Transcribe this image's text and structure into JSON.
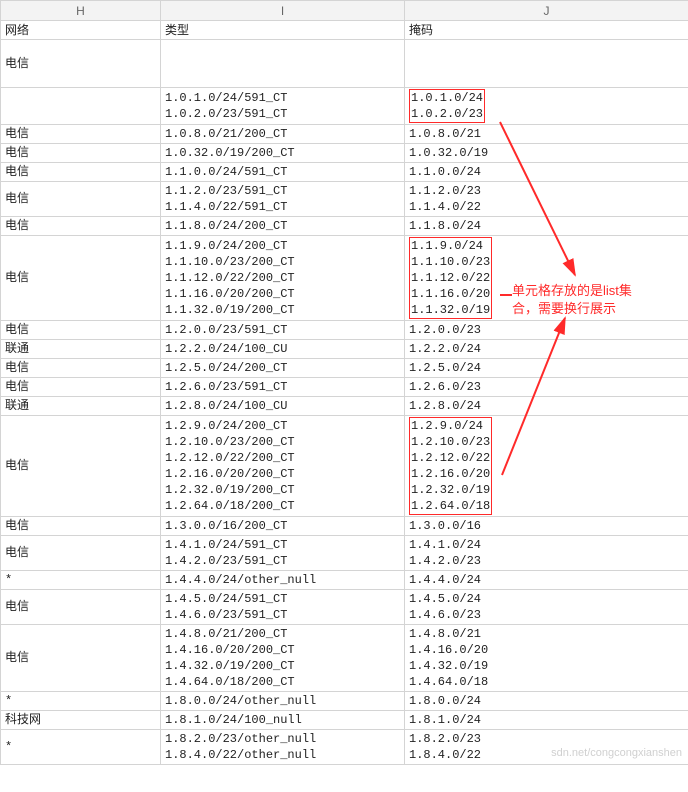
{
  "columns": {
    "H": "H",
    "I": "I",
    "J": "J"
  },
  "headerRow": {
    "H": "网络",
    "I": "类型",
    "J": "掩码"
  },
  "annotation": {
    "line1": "单元格存放的是list集",
    "line2": "合，需要换行展示"
  },
  "watermark": "sdn.net/congcongxianshen",
  "rows": [
    {
      "h": "电信",
      "i": [
        ""
      ],
      "j": [
        ""
      ],
      "jbox": false,
      "blank": true
    },
    {
      "h": "",
      "i": [
        "1.0.1.0/24/591_CT",
        "1.0.2.0/23/591_CT"
      ],
      "j": [
        "1.0.1.0/24",
        "1.0.2.0/23"
      ],
      "jbox": true
    },
    {
      "h": "电信",
      "i": [
        "1.0.8.0/21/200_CT"
      ],
      "j": [
        "1.0.8.0/21"
      ],
      "jbox": false
    },
    {
      "h": "电信",
      "i": [
        "1.0.32.0/19/200_CT"
      ],
      "j": [
        "1.0.32.0/19"
      ],
      "jbox": false
    },
    {
      "h": "电信",
      "i": [
        "1.1.0.0/24/591_CT"
      ],
      "j": [
        "1.1.0.0/24"
      ],
      "jbox": false
    },
    {
      "h": "电信",
      "i": [
        "1.1.2.0/23/591_CT",
        "1.1.4.0/22/591_CT"
      ],
      "j": [
        "1.1.2.0/23",
        "1.1.4.0/22"
      ],
      "jbox": false
    },
    {
      "h": "电信",
      "i": [
        "1.1.8.0/24/200_CT"
      ],
      "j": [
        "1.1.8.0/24"
      ],
      "jbox": false
    },
    {
      "h": "电信",
      "i": [
        "1.1.9.0/24/200_CT",
        "1.1.10.0/23/200_CT",
        "1.1.12.0/22/200_CT",
        "1.1.16.0/20/200_CT",
        "1.1.32.0/19/200_CT"
      ],
      "j": [
        "1.1.9.0/24",
        "1.1.10.0/23",
        "1.1.12.0/22",
        "1.1.16.0/20",
        "1.1.32.0/19"
      ],
      "jbox": true
    },
    {
      "h": "电信",
      "i": [
        "1.2.0.0/23/591_CT"
      ],
      "j": [
        "1.2.0.0/23"
      ],
      "jbox": false
    },
    {
      "h": "联通",
      "i": [
        "1.2.2.0/24/100_CU"
      ],
      "j": [
        "1.2.2.0/24"
      ],
      "jbox": false
    },
    {
      "h": "电信",
      "i": [
        "1.2.5.0/24/200_CT"
      ],
      "j": [
        "1.2.5.0/24"
      ],
      "jbox": false
    },
    {
      "h": "电信",
      "i": [
        "1.2.6.0/23/591_CT"
      ],
      "j": [
        "1.2.6.0/23"
      ],
      "jbox": false
    },
    {
      "h": "联通",
      "i": [
        "1.2.8.0/24/100_CU"
      ],
      "j": [
        "1.2.8.0/24"
      ],
      "jbox": false
    },
    {
      "h": "电信",
      "i": [
        "1.2.9.0/24/200_CT",
        "1.2.10.0/23/200_CT",
        "1.2.12.0/22/200_CT",
        "1.2.16.0/20/200_CT",
        "1.2.32.0/19/200_CT",
        "1.2.64.0/18/200_CT"
      ],
      "j": [
        "1.2.9.0/24",
        "1.2.10.0/23",
        "1.2.12.0/22",
        "1.2.16.0/20",
        "1.2.32.0/19",
        "1.2.64.0/18"
      ],
      "jbox": true
    },
    {
      "h": "电信",
      "i": [
        "1.3.0.0/16/200_CT"
      ],
      "j": [
        "1.3.0.0/16"
      ],
      "jbox": false
    },
    {
      "h": "电信",
      "i": [
        "1.4.1.0/24/591_CT",
        "1.4.2.0/23/591_CT"
      ],
      "j": [
        "1.4.1.0/24",
        "1.4.2.0/23"
      ],
      "jbox": false
    },
    {
      "h": "*",
      "i": [
        "1.4.4.0/24/other_null"
      ],
      "j": [
        "1.4.4.0/24"
      ],
      "jbox": false
    },
    {
      "h": "电信",
      "i": [
        "1.4.5.0/24/591_CT",
        "1.4.6.0/23/591_CT"
      ],
      "j": [
        "1.4.5.0/24",
        "1.4.6.0/23"
      ],
      "jbox": false
    },
    {
      "h": "电信",
      "i": [
        "1.4.8.0/21/200_CT",
        "1.4.16.0/20/200_CT",
        "1.4.32.0/19/200_CT",
        "1.4.64.0/18/200_CT"
      ],
      "j": [
        "1.4.8.0/21",
        "1.4.16.0/20",
        "1.4.32.0/19",
        "1.4.64.0/18"
      ],
      "jbox": false
    },
    {
      "h": "*",
      "i": [
        "1.8.0.0/24/other_null"
      ],
      "j": [
        "1.8.0.0/24"
      ],
      "jbox": false
    },
    {
      "h": "科技网",
      "i": [
        "1.8.1.0/24/100_null"
      ],
      "j": [
        "1.8.1.0/24"
      ],
      "jbox": false
    },
    {
      "h": "*",
      "i": [
        "1.8.2.0/23/other_null",
        "1.8.4.0/22/other_null"
      ],
      "j": [
        "1.8.2.0/23",
        "1.8.4.0/22"
      ],
      "jbox": false
    }
  ]
}
